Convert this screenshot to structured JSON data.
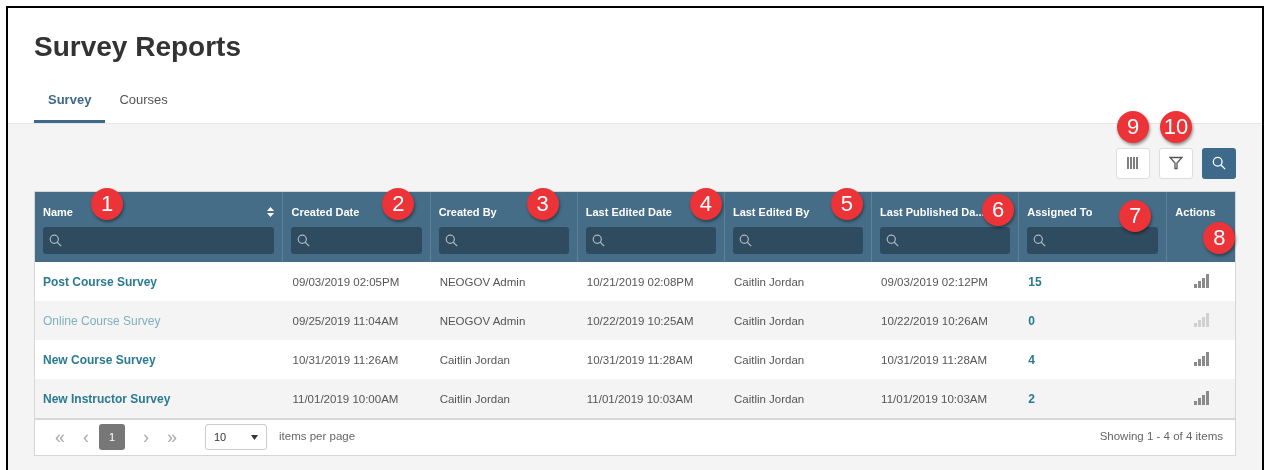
{
  "page": {
    "title": "Survey Reports"
  },
  "tabs": [
    {
      "label": "Survey",
      "selected": true
    },
    {
      "label": "Courses",
      "selected": false
    }
  ],
  "toolbar": [
    {
      "kind": "columns",
      "callout": "9"
    },
    {
      "kind": "filter",
      "callout": "10"
    },
    {
      "kind": "search"
    }
  ],
  "table": {
    "columns": [
      {
        "label": "Name",
        "sortable": true,
        "filter": true,
        "callout": "1"
      },
      {
        "label": "Created Date",
        "sortable": false,
        "filter": true,
        "callout": "2"
      },
      {
        "label": "Created By",
        "sortable": false,
        "filter": true,
        "callout": "3"
      },
      {
        "label": "Last Edited Date",
        "sortable": false,
        "filter": true,
        "callout": "4"
      },
      {
        "label": "Last Edited By",
        "sortable": false,
        "filter": true,
        "callout": "5"
      },
      {
        "label": "Last Published Da...",
        "sortable": false,
        "filter": true,
        "callout": "6"
      },
      {
        "label": "Assigned To",
        "sortable": false,
        "filter": true,
        "callout": "7"
      },
      {
        "label": "Actions",
        "sortable": false,
        "filter": false,
        "callout": "8"
      }
    ],
    "rows": [
      {
        "name": "Post Course Survey",
        "created_date": "09/03/2019 02:05PM",
        "created_by": "NEOGOV Admin",
        "last_edited_date": "10/21/2019 02:08PM",
        "last_edited_by": "Caitlin Jordan",
        "last_published": "09/03/2019 02:12PM",
        "assigned_to": "15",
        "disabled": false
      },
      {
        "name": "Online Course Survey",
        "created_date": "09/25/2019 11:04AM",
        "created_by": "NEOGOV Admin",
        "last_edited_date": "10/22/2019 10:25AM",
        "last_edited_by": "Caitlin Jordan",
        "last_published": "10/22/2019 10:26AM",
        "assigned_to": "0",
        "disabled": true
      },
      {
        "name": "New Course Survey",
        "created_date": "10/31/2019 11:26AM",
        "created_by": "Caitlin Jordan",
        "last_edited_date": "10/31/2019 11:28AM",
        "last_edited_by": "Caitlin Jordan",
        "last_published": "10/31/2019 11:28AM",
        "assigned_to": "4",
        "disabled": false
      },
      {
        "name": "New Instructor Survey",
        "created_date": "11/01/2019 10:00AM",
        "created_by": "Caitlin Jordan",
        "last_edited_date": "11/01/2019 10:03AM",
        "last_edited_by": "Caitlin Jordan",
        "last_published": "11/01/2019 10:03AM",
        "assigned_to": "2",
        "disabled": false
      }
    ]
  },
  "pager": {
    "first": "«",
    "prev": "‹",
    "pages": [
      {
        "label": "1",
        "selected": true
      }
    ],
    "next": "›",
    "last": "»",
    "page_size": "10",
    "page_size_label": "items per page",
    "summary": "Showing 1 - 4 of 4 items"
  }
}
